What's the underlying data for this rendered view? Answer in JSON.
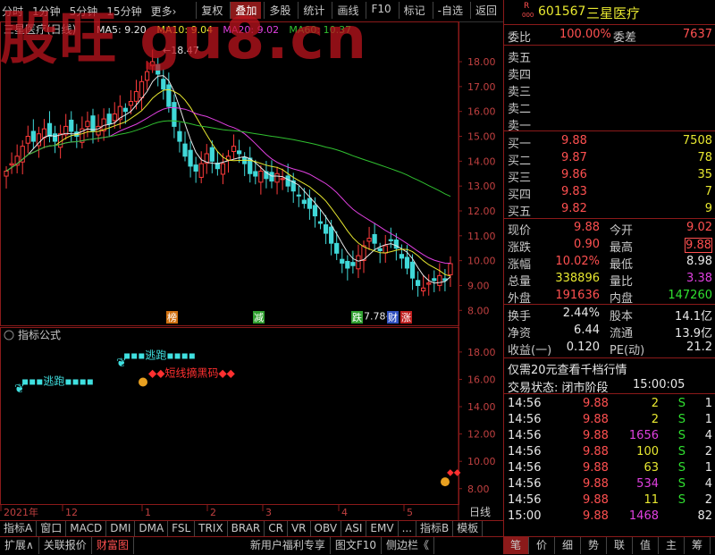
{
  "watermark": "股旺 gu8.cn",
  "toolbar": {
    "left": [
      "分时",
      "1分钟",
      "5分钟",
      "15分钟",
      "更多›"
    ],
    "right": [
      "复权",
      "叠加",
      "多股",
      "统计",
      "画线",
      "F10",
      "标记",
      "-自选",
      "返回"
    ],
    "active": "叠加"
  },
  "chart": {
    "title": "三星医疗(日线)",
    "ma": [
      {
        "label": "MA5: 9.20",
        "color": "#e8e8e8"
      },
      {
        "label": "MA10: 9.04",
        "color": "#e8e830"
      },
      {
        "label": "MA20: 9.02",
        "color": "#e040e0"
      },
      {
        "label": "MA60: 10.37",
        "color": "#30c030"
      }
    ],
    "high_label": "18.47",
    "low_label": "7.78",
    "y_ticks": [
      "18.00",
      "17.00",
      "16.00",
      "15.00",
      "14.00",
      "13.00",
      "12.00",
      "11.00",
      "10.00",
      "9.00",
      "8.00"
    ],
    "markers": [
      {
        "text": "榜",
        "color": "#d07010"
      },
      {
        "text": "减",
        "color": "#30a030"
      },
      {
        "text": "跌",
        "color": "#30a030"
      },
      {
        "text": "财",
        "color": "#3050c0"
      },
      {
        "text": "涨",
        "color": "#c02020"
      }
    ]
  },
  "indicator": {
    "title": "指标公式",
    "y_ticks": [
      "18.00",
      "16.00",
      "14.00",
      "12.00",
      "10.00",
      "8.00"
    ],
    "labels": {
      "escape": "逃跑",
      "short": "短线摘黑码"
    }
  },
  "x_axis": {
    "labels": [
      "2021年",
      "12",
      "1",
      "2",
      "3",
      "4",
      "5"
    ],
    "period": "日线"
  },
  "tabs1": [
    "指标A",
    "窗口",
    "MACD",
    "DMI",
    "DMA",
    "FSL",
    "TRIX",
    "BRAR",
    "CR",
    "VR",
    "OBV",
    "ASI",
    "EMV",
    "...",
    "指标B",
    "模板"
  ],
  "tabs2": [
    "扩展∧",
    "关联报价",
    "财富图",
    "新用户福利专享",
    "图文F10",
    "侧边栏《"
  ],
  "tabs2_right": [
    "笔",
    "价",
    "细",
    "势",
    "联",
    "值",
    "主",
    "筹"
  ],
  "quote": {
    "r_badge": "R",
    "code_small": "000",
    "code": "601567",
    "name": "三星医疗",
    "weibi_label": "委比",
    "weibi": "100.00%",
    "weicha_label": "委差",
    "weicha": "7637",
    "sells": [
      "卖五",
      "卖四",
      "卖三",
      "卖二",
      "卖一"
    ],
    "buys": [
      {
        "label": "买一",
        "price": "9.88",
        "vol": "7508"
      },
      {
        "label": "买二",
        "price": "9.87",
        "vol": "78"
      },
      {
        "label": "买三",
        "price": "9.86",
        "vol": "35"
      },
      {
        "label": "买四",
        "price": "9.83",
        "vol": "7"
      },
      {
        "label": "买五",
        "price": "9.82",
        "vol": "9"
      }
    ],
    "stats": [
      {
        "l1": "现价",
        "v1": "9.88",
        "c1": "red",
        "l2": "今开",
        "v2": "9.02",
        "c2": "red"
      },
      {
        "l1": "涨跌",
        "v1": "0.90",
        "c1": "red",
        "l2": "最高",
        "v2": "9.88",
        "c2": "red"
      },
      {
        "l1": "涨幅",
        "v1": "10.02%",
        "c1": "red",
        "l2": "最低",
        "v2": "8.98",
        "c2": "wht"
      },
      {
        "l1": "总量",
        "v1": "338896",
        "c1": "yel",
        "l2": "量比",
        "v2": "3.38",
        "c2": "mag"
      },
      {
        "l1": "外盘",
        "v1": "191636",
        "c1": "red",
        "l2": "内盘",
        "v2": "147260",
        "c2": "grn"
      }
    ],
    "stats2": [
      {
        "l1": "换手",
        "v1": "2.44%",
        "l2": "股本",
        "v2": "14.1亿"
      },
      {
        "l1": "净资",
        "v1": "6.44",
        "l2": "流通",
        "v2": "13.9亿"
      },
      {
        "l1": "收益(一)",
        "v1": "0.120",
        "l2": "PE(动)",
        "v2": "21.2"
      }
    ],
    "promo": "仅需20元查看千档行情",
    "status_label": "交易状态: 闭市阶段",
    "status_time": "15:00:05",
    "ticks": [
      {
        "t": "14:56",
        "p": "9.88",
        "v": "2",
        "vc": "yel",
        "s": "S",
        "n": "1"
      },
      {
        "t": "14:56",
        "p": "9.88",
        "v": "2",
        "vc": "yel",
        "s": "S",
        "n": "1"
      },
      {
        "t": "14:56",
        "p": "9.88",
        "v": "1656",
        "vc": "mag",
        "s": "S",
        "n": "4"
      },
      {
        "t": "14:56",
        "p": "9.88",
        "v": "100",
        "vc": "yel",
        "s": "S",
        "n": "2"
      },
      {
        "t": "14:56",
        "p": "9.88",
        "v": "63",
        "vc": "yel",
        "s": "S",
        "n": "1"
      },
      {
        "t": "14:56",
        "p": "9.88",
        "v": "534",
        "vc": "mag",
        "s": "S",
        "n": "4"
      },
      {
        "t": "14:56",
        "p": "9.88",
        "v": "11",
        "vc": "yel",
        "s": "S",
        "n": "2"
      },
      {
        "t": "15:00",
        "p": "9.88",
        "v": "1468",
        "vc": "mag",
        "s": "",
        "n": "82"
      }
    ]
  }
}
